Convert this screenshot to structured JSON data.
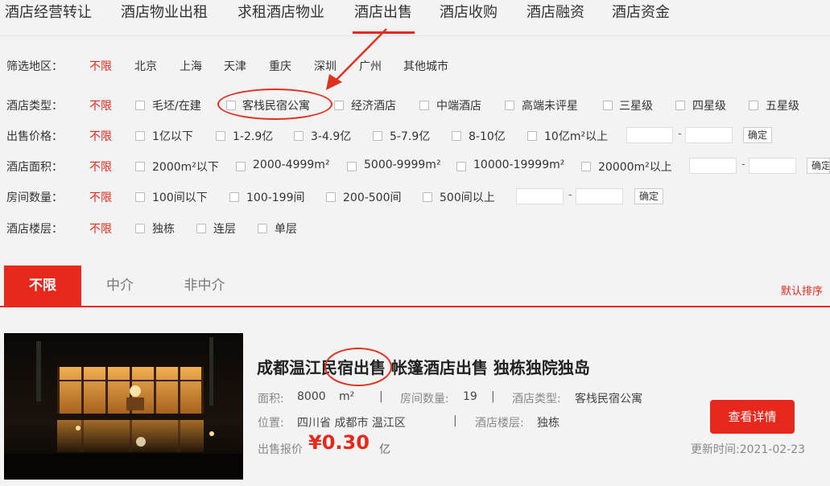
{
  "nav": {
    "items": [
      "酒店经营转让",
      "酒店物业出租",
      "求租酒店物业",
      "酒店出售",
      "酒店收购",
      "酒店融资",
      "酒店资金"
    ],
    "active_index": 3
  },
  "filters": {
    "region": {
      "label": "筛选地区：",
      "all": "不限",
      "options": [
        "北京",
        "上海",
        "天津",
        "重庆",
        "深圳",
        "广州",
        "其他城市"
      ]
    },
    "type": {
      "label": "酒店类型：",
      "all": "不限",
      "options": [
        "毛坯/在建",
        "客栈民宿公寓",
        "经济酒店",
        "中端酒店",
        "高端未评星",
        "三星级",
        "四星级",
        "五星级"
      ]
    },
    "price": {
      "label": "出售价格：",
      "all": "不限",
      "options": [
        "1亿以下",
        "1-2.9亿",
        "3-4.9亿",
        "5-7.9亿",
        "8-10亿",
        "10亿m²以上"
      ],
      "confirm": "确定",
      "dash": "-"
    },
    "area": {
      "label": "酒店面积：",
      "all": "不限",
      "options": [
        "2000m²以下",
        "2000-4999m²",
        "5000-9999m²",
        "10000-19999m²",
        "20000m²以上"
      ],
      "confirm": "确定",
      "dash": "-"
    },
    "rooms": {
      "label": "房间数量：",
      "all": "不限",
      "options": [
        "100间以下",
        "100-199间",
        "200-500间",
        "500间以上"
      ],
      "confirm": "确定",
      "dash": "-"
    },
    "floors": {
      "label": "酒店楼层：",
      "all": "不限",
      "options": [
        "独栋",
        "连层",
        "单层"
      ]
    }
  },
  "tabs": {
    "items": [
      "不限",
      "中介",
      "非中介"
    ],
    "active_index": 0,
    "sort": "默认排序"
  },
  "listing": {
    "title": "成都温江民宿出售 帐篷酒店出售 独栋独院独岛",
    "area_label": "面积:",
    "area_value": "8000",
    "area_unit": "m²",
    "rooms_label": "房间数量:",
    "rooms_value": "19",
    "type_label": "酒店类型:",
    "type_value": "客栈民宿公寓",
    "location_label": "位置:",
    "location_value": "四川省 成都市 温江区",
    "floor_label": "酒店楼层:",
    "floor_value": "独栋",
    "price_label": "出售报价",
    "price_value": "¥0.30",
    "price_unit": "亿",
    "detail_button": "查看详情",
    "update_label": "更新时间:",
    "update_value": "2021-02-23",
    "separator": "|"
  },
  "colors": {
    "accent": "#e8281c",
    "background": "#f3f3f3",
    "annotation": "#e03020"
  }
}
